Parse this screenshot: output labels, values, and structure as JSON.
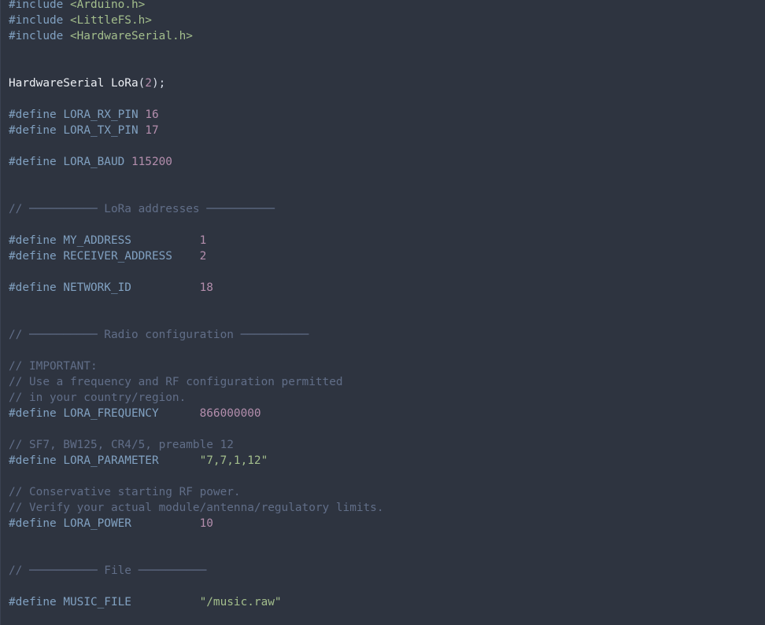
{
  "lines": [
    {
      "kind": "include",
      "directive": "#include",
      "header": "<Arduino.h>"
    },
    {
      "kind": "include",
      "directive": "#include",
      "header": "<LittleFS.h>"
    },
    {
      "kind": "include",
      "directive": "#include",
      "header": "<HardwareSerial.h>"
    },
    {
      "kind": "blank"
    },
    {
      "kind": "blank"
    },
    {
      "kind": "decl",
      "type": "HardwareSerial",
      "name": "LoRa",
      "open": "(",
      "arg": "2",
      "close": ");"
    },
    {
      "kind": "blank"
    },
    {
      "kind": "define",
      "directive": "#define",
      "name": "LORA_RX_PIN",
      "pad": " ",
      "value": "16",
      "vtype": "num"
    },
    {
      "kind": "define",
      "directive": "#define",
      "name": "LORA_TX_PIN",
      "pad": " ",
      "value": "17",
      "vtype": "num"
    },
    {
      "kind": "blank"
    },
    {
      "kind": "define",
      "directive": "#define",
      "name": "LORA_BAUD",
      "pad": " ",
      "value": "115200",
      "vtype": "num"
    },
    {
      "kind": "blank"
    },
    {
      "kind": "blank"
    },
    {
      "kind": "comment",
      "text": "// ────────── LoRa addresses ──────────"
    },
    {
      "kind": "blank"
    },
    {
      "kind": "define",
      "directive": "#define",
      "name": "MY_ADDRESS",
      "pad": "          ",
      "value": "1",
      "vtype": "num"
    },
    {
      "kind": "define",
      "directive": "#define",
      "name": "RECEIVER_ADDRESS",
      "pad": "    ",
      "value": "2",
      "vtype": "num"
    },
    {
      "kind": "blank"
    },
    {
      "kind": "define",
      "directive": "#define",
      "name": "NETWORK_ID",
      "pad": "          ",
      "value": "18",
      "vtype": "num"
    },
    {
      "kind": "blank"
    },
    {
      "kind": "blank"
    },
    {
      "kind": "comment",
      "text": "// ────────── Radio configuration ──────────"
    },
    {
      "kind": "blank"
    },
    {
      "kind": "comment",
      "text": "// IMPORTANT:"
    },
    {
      "kind": "comment",
      "text": "// Use a frequency and RF configuration permitted"
    },
    {
      "kind": "comment",
      "text": "// in your country/region."
    },
    {
      "kind": "define",
      "directive": "#define",
      "name": "LORA_FREQUENCY",
      "pad": "      ",
      "value": "866000000",
      "vtype": "num"
    },
    {
      "kind": "blank"
    },
    {
      "kind": "comment",
      "text": "// SF7, BW125, CR4/5, preamble 12"
    },
    {
      "kind": "define",
      "directive": "#define",
      "name": "LORA_PARAMETER",
      "pad": "      ",
      "value": "\"7,7,1,12\"",
      "vtype": "str"
    },
    {
      "kind": "blank"
    },
    {
      "kind": "comment",
      "text": "// Conservative starting RF power."
    },
    {
      "kind": "comment",
      "text": "// Verify your actual module/antenna/regulatory limits."
    },
    {
      "kind": "define",
      "directive": "#define",
      "name": "LORA_POWER",
      "pad": "          ",
      "value": "10",
      "vtype": "num"
    },
    {
      "kind": "blank"
    },
    {
      "kind": "blank"
    },
    {
      "kind": "comment",
      "text": "// ────────── File ──────────"
    },
    {
      "kind": "blank"
    },
    {
      "kind": "define",
      "directive": "#define",
      "name": "MUSIC_FILE",
      "pad": "          ",
      "value": "\"/music.raw\"",
      "vtype": "str"
    }
  ],
  "colors": {
    "background": "#2e3440",
    "keyword": "#81a1c1",
    "string": "#a3be8c",
    "number": "#b48ead",
    "comment": "#616e88",
    "identifier": "#eceff4"
  }
}
